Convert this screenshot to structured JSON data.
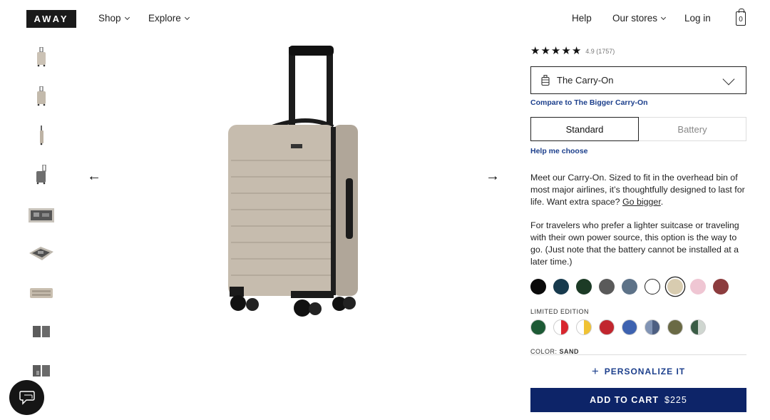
{
  "brand": {
    "logo_text": "AWAY"
  },
  "nav": {
    "left": [
      {
        "label": "Shop"
      },
      {
        "label": "Explore"
      }
    ],
    "help": "Help",
    "stores": "Our stores",
    "login": "Log in",
    "bag_count": "0"
  },
  "thumbnails": [
    {
      "name": "front"
    },
    {
      "name": "angle"
    },
    {
      "name": "side"
    },
    {
      "name": "back"
    },
    {
      "name": "open-top"
    },
    {
      "name": "open-angle"
    },
    {
      "name": "flat"
    },
    {
      "name": "interior-1"
    },
    {
      "name": "interior-2"
    }
  ],
  "product": {
    "rating_stars": 5,
    "rating_text": "4.9 (1757)",
    "selected_product": "The Carry-On",
    "compare_link": "Compare to The Bigger Carry-On",
    "options": {
      "standard": "Standard",
      "battery": "Battery"
    },
    "help_link": "Help me choose",
    "description_1": "Meet our Carry-On. Sized to fit in the overhead bin of most major airlines, it’s thoughtfully designed to last for life. Want extra space?",
    "go_bigger": "Go bigger",
    "description_2": "For travelers who prefer a lighter suitcase or traveling with their own power source, this option is the way to go. (Just note that the battery cannot be installed at a later time.)",
    "colors": [
      "#0a0a0a",
      "#173a4d",
      "#1c3b26",
      "#5a5a5a",
      "#5d7288",
      "#ffffff",
      "#d8ccb0",
      "#efc6d3",
      "#8c3c3e"
    ],
    "selected_color_index": 6,
    "limited_edition_label": "LIMITED EDITION",
    "limited_colors": [
      {
        "a": "#1d5a35",
        "b": "#1d5a35"
      },
      {
        "a": "#ffffff",
        "b": "#d8262e"
      },
      {
        "a": "#ffffff",
        "b": "#f0c233"
      },
      {
        "a": "#c1262e",
        "b": "#c1262e"
      },
      {
        "a": "#3d62b0",
        "b": "#3d62b0"
      },
      {
        "a": "#8194b5",
        "b": "#4d5f82"
      },
      {
        "a": "#6a6a45",
        "b": "#6a6a45"
      },
      {
        "a": "#3a5c45",
        "b": "#cfd6d0"
      }
    ],
    "color_label": "COLOR:",
    "color_value": "SAND",
    "personalize": "PERSONALIZE IT",
    "add_to_cart": "ADD TO CART",
    "price": "$225"
  }
}
